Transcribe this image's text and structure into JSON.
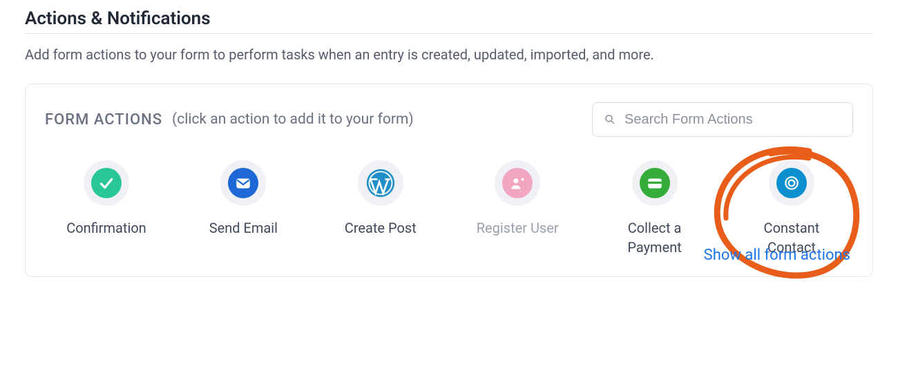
{
  "section": {
    "title": "Actions & Notifications",
    "description": "Add form actions to your form to perform tasks when an entry is created, updated, imported, and more."
  },
  "panel": {
    "title": "FORM ACTIONS",
    "hint": "(click an action to add it to your form)",
    "search_placeholder": "Search Form Actions",
    "show_all_label": "Show all form actions"
  },
  "actions": [
    {
      "id": "confirmation",
      "label": "Confirmation",
      "icon": "check",
      "color": "green",
      "muted": false
    },
    {
      "id": "send-email",
      "label": "Send Email",
      "icon": "envelope",
      "color": "blue",
      "muted": false
    },
    {
      "id": "create-post",
      "label": "Create Post",
      "icon": "wordpress",
      "color": "wp",
      "muted": false
    },
    {
      "id": "register-user",
      "label": "Register User",
      "icon": "user-plus",
      "color": "pink",
      "muted": true
    },
    {
      "id": "collect-payment",
      "label": "Collect a\nPayment",
      "icon": "card",
      "color": "pay",
      "muted": false
    },
    {
      "id": "constant-contact",
      "label": "Constant\nContact",
      "icon": "target",
      "color": "cc",
      "muted": false,
      "highlighted": true
    }
  ]
}
